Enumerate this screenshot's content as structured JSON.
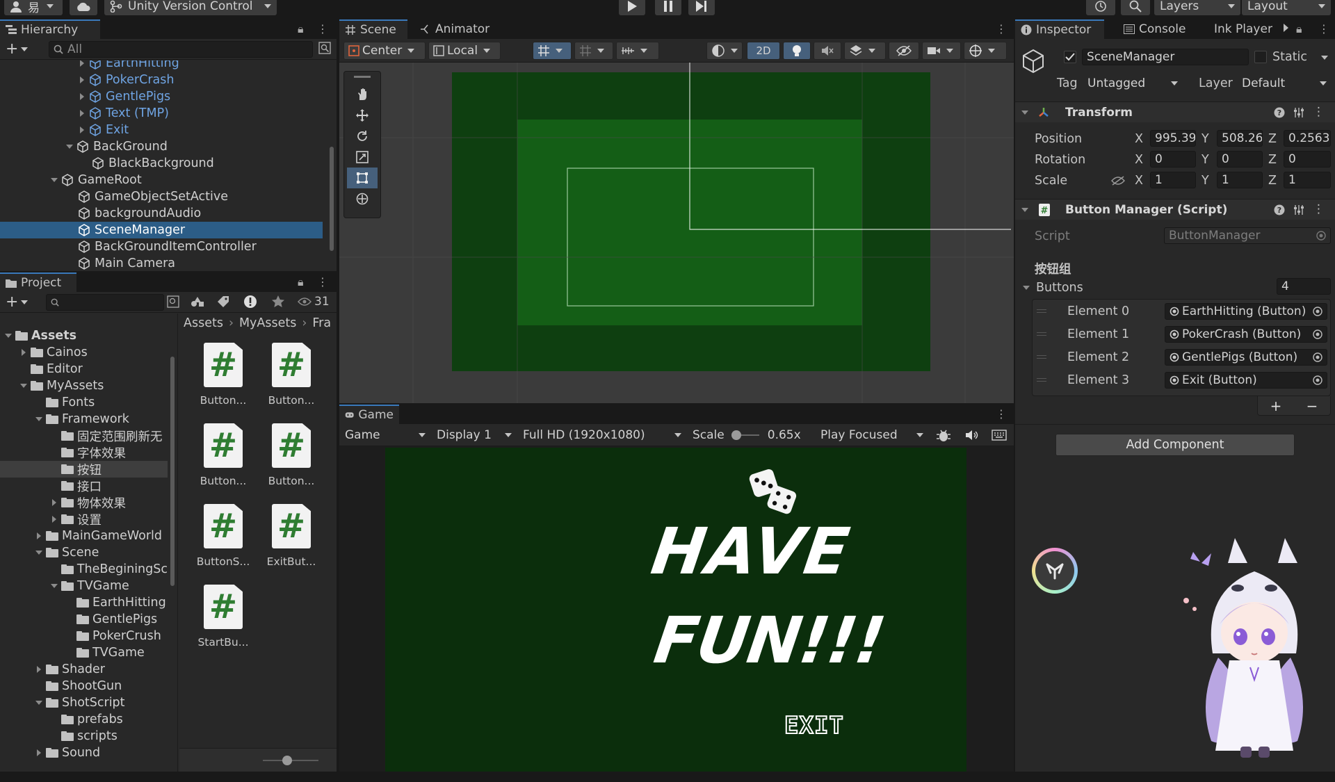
{
  "topbar": {
    "account_initial": "易",
    "version_control": "Unity Version Control",
    "layers": "Layers",
    "layout": "Layout"
  },
  "hierarchy": {
    "tab": "Hierarchy",
    "search_placeholder": "All",
    "rows": [
      {
        "label": "EarthHitting"
      },
      {
        "label": "PokerCrash"
      },
      {
        "label": "GentlePigs"
      },
      {
        "label": "Text (TMP)"
      },
      {
        "label": "Exit"
      },
      {
        "label": "BackGround"
      },
      {
        "label": "BlackBackground"
      },
      {
        "label": "GameRoot"
      },
      {
        "label": "GameObjectSetActive"
      },
      {
        "label": "backgroundAudio"
      },
      {
        "label": "SceneManager"
      },
      {
        "label": "BackGroundItemController"
      },
      {
        "label": "Main Camera"
      }
    ]
  },
  "project": {
    "tab": "Project",
    "hidden_count": "31",
    "breadcrumb": [
      "Assets",
      "MyAssets",
      "Fra"
    ],
    "tree": [
      {
        "label": "Assets"
      },
      {
        "label": "Cainos"
      },
      {
        "label": "Editor"
      },
      {
        "label": "MyAssets"
      },
      {
        "label": "Fonts"
      },
      {
        "label": "Framework"
      },
      {
        "label": "固定范围刷新无"
      },
      {
        "label": "字体效果"
      },
      {
        "label": "按钮"
      },
      {
        "label": "接口"
      },
      {
        "label": "物体效果"
      },
      {
        "label": "设置"
      },
      {
        "label": "MainGameWorld"
      },
      {
        "label": "Scene"
      },
      {
        "label": "TheBeginingSc"
      },
      {
        "label": "TVGame"
      },
      {
        "label": "EarthHitting"
      },
      {
        "label": "GentlePigs"
      },
      {
        "label": "PokerCrush"
      },
      {
        "label": "TVGame"
      },
      {
        "label": "Shader"
      },
      {
        "label": "ShootGun"
      },
      {
        "label": "ShotScript"
      },
      {
        "label": "prefabs"
      },
      {
        "label": "scripts"
      },
      {
        "label": "Sound"
      }
    ],
    "assets": [
      {
        "label": "Button..."
      },
      {
        "label": "Button..."
      },
      {
        "label": "Button..."
      },
      {
        "label": "Button..."
      },
      {
        "label": "ButtonS..."
      },
      {
        "label": "ExitBut..."
      },
      {
        "label": "StartBu..."
      }
    ],
    "script_glyph": "#"
  },
  "scene": {
    "tab": "Scene",
    "tab2": "Animator",
    "pivot": "Center",
    "space": "Local",
    "mode_2d": "2D"
  },
  "game": {
    "tab": "Game",
    "view": "Game",
    "display": "Display 1",
    "resolution": "Full HD (1920x1080)",
    "scale_label": "Scale",
    "scale_value": "0.65x",
    "play_mode": "Play Focused",
    "title_line1": "HAVE",
    "title_line2": "FUN!!!",
    "exit": "EXIT"
  },
  "inspector": {
    "tabs": [
      "Inspector",
      "Console",
      "Ink Player"
    ],
    "object_name": "SceneManager",
    "static": "Static",
    "tag_label": "Tag",
    "tag_value": "Untagged",
    "layer_label": "Layer",
    "layer_value": "Default",
    "transform": {
      "title": "Transform",
      "position": {
        "label": "Position",
        "x": "995.39",
        "y": "508.26",
        "z": "0.2563"
      },
      "rotation": {
        "label": "Rotation",
        "x": "0",
        "y": "0",
        "z": "0"
      },
      "scale": {
        "label": "Scale",
        "x": "1",
        "y": "1",
        "z": "1"
      }
    },
    "script_component": {
      "title": "Button Manager (Script)",
      "script_label": "Script",
      "script_value": "ButtonManager",
      "group_header": "按钮组",
      "buttons_label": "Buttons",
      "buttons_count": "4",
      "elements": [
        {
          "label": "Element 0",
          "value": "EarthHitting (Button)"
        },
        {
          "label": "Element 1",
          "value": "PokerCrash (Button)"
        },
        {
          "label": "Element 2",
          "value": "GentlePigs (Button)"
        },
        {
          "label": "Element 3",
          "value": "Exit (Button)"
        }
      ]
    },
    "add_component": "Add Component"
  },
  "axis_letters": {
    "x": "X",
    "y": "Y",
    "z": "Z"
  },
  "colors": {
    "panel": "#282828",
    "selection": "#2c5d87",
    "game_bg": "#0b2e0c",
    "scene_outer": "#0e3f10",
    "scene_inner": "#145e16",
    "accent_blue": "#3a79bb"
  }
}
